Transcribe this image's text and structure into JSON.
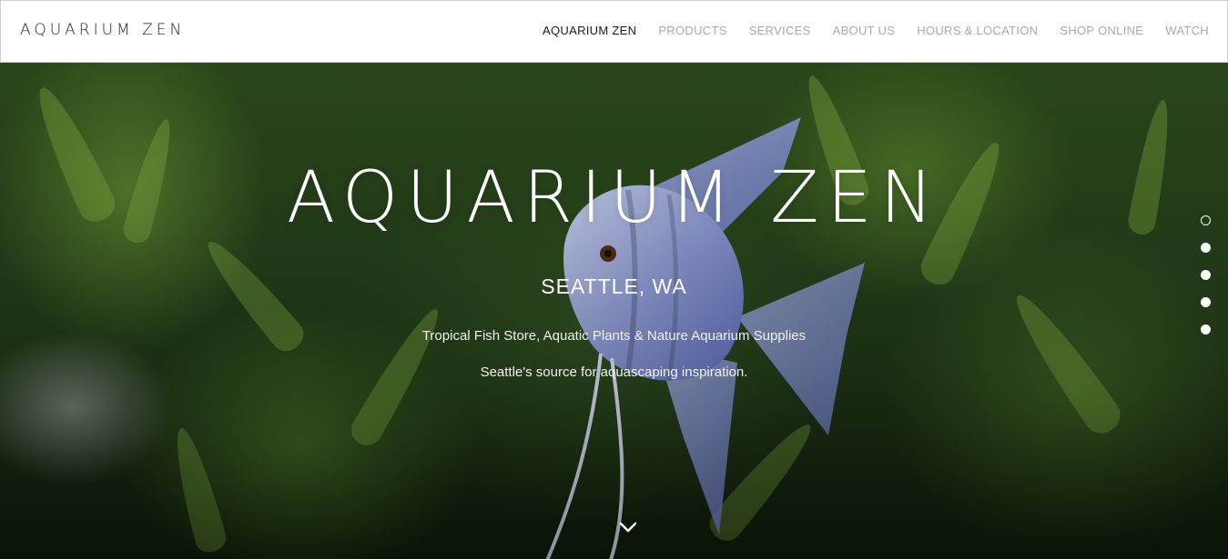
{
  "header": {
    "logo": "AQUARIUM ZEN",
    "nav": [
      {
        "label": "AQUARIUM ZEN",
        "active": true
      },
      {
        "label": "PRODUCTS",
        "active": false
      },
      {
        "label": "SERVICES",
        "active": false
      },
      {
        "label": "ABOUT US",
        "active": false
      },
      {
        "label": "HOURS & LOCATION",
        "active": false
      },
      {
        "label": "SHOP ONLINE",
        "active": false
      },
      {
        "label": "WATCH",
        "active": false
      }
    ]
  },
  "hero": {
    "title": "AQUARIUM ZEN",
    "location": "SEATTLE, WA",
    "tagline": "Tropical Fish Store, Aquatic Plants & Nature Aquarium Supplies",
    "subline": "Seattle's source for aquascaping inspiration.",
    "scroll_icon": "chevron-down-icon"
  },
  "section_nav": {
    "count": 5,
    "active_index": 0
  },
  "colors": {
    "header_bg": "#ffffff",
    "nav_active": "#1a1a1a",
    "nav_inactive": "#aaaaaa",
    "hero_text": "#ffffff"
  }
}
